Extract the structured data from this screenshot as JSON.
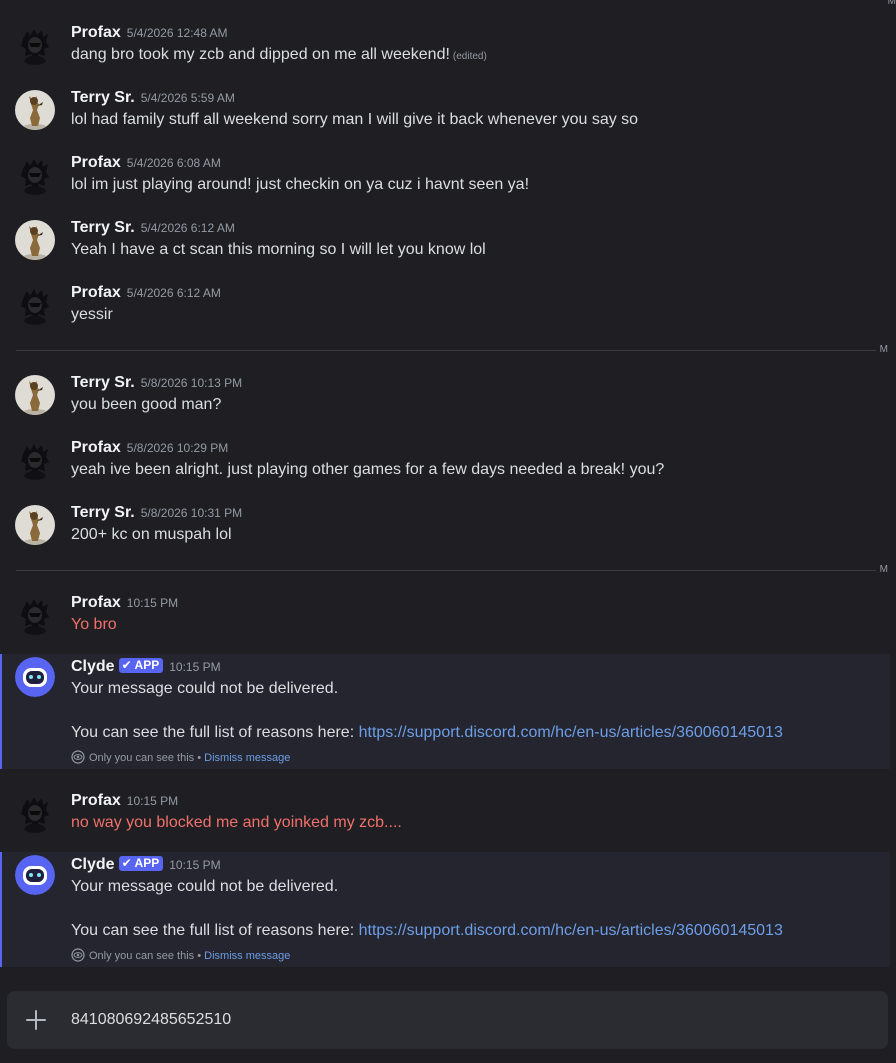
{
  "messages": [
    {
      "author": "Profax",
      "timestamp": "5/4/2026 12:48 AM",
      "text": "dang bro took my zcb and dipped on me all weekend!",
      "edited": "(edited)"
    },
    {
      "author": "Terry Sr.",
      "timestamp": "5/4/2026 5:59 AM",
      "text": "lol had family stuff all weekend sorry man I will give it back whenever you say so"
    },
    {
      "author": "Profax",
      "timestamp": "5/4/2026 6:08 AM",
      "text": "lol im just playing around! just checkin on ya cuz i havnt seen ya!"
    },
    {
      "author": "Terry Sr.",
      "timestamp": "5/4/2026 6:12 AM",
      "text": "Yeah I have a ct scan this morning so I will let you know lol"
    },
    {
      "author": "Profax",
      "timestamp": "5/4/2026 6:12 AM",
      "text": "yessir"
    },
    {
      "author": "Terry Sr.",
      "timestamp": "5/8/2026 10:13 PM",
      "text": "you been good man?"
    },
    {
      "author": "Profax",
      "timestamp": "5/8/2026 10:29 PM",
      "text": "yeah ive been alright. just playing other games for a few days needed a break! you?"
    },
    {
      "author": "Terry Sr.",
      "timestamp": "5/8/2026 10:31 PM",
      "text": "200+ kc on muspah lol"
    },
    {
      "author": "Profax",
      "timestamp": "10:15 PM",
      "text": "Yo bro",
      "failed": true
    },
    {
      "author": "Profax",
      "timestamp": "10:15 PM",
      "text": "no way you blocked me and yoinked my zcb....",
      "failed": true
    }
  ],
  "dividers": [
    {
      "mark": "M"
    },
    {
      "mark": "M"
    }
  ],
  "top_mark": "M",
  "clyde": {
    "author": "Clyde",
    "badge": "APP",
    "timestamp": "10:15 PM",
    "line1": "Your message could not be delivered.",
    "line2_prefix": "You can see the full list of reasons here:",
    "link": "https://support.discord.com/hc/en-us/articles/360060145013",
    "note": "Only you can see this",
    "separator": "•",
    "dismiss": "Dismiss message"
  },
  "composer": {
    "value": "841080692485652510"
  },
  "colors": {
    "background": "#1f1f23",
    "clyde_background": "#24252e",
    "accent": "#5865f2",
    "link": "#6d9ee8",
    "failed_text": "#f0706a"
  },
  "icons": [
    "profax-avatar",
    "terry-avatar",
    "clyde-avatar",
    "checkmark-icon",
    "eye-icon",
    "plus-icon"
  ]
}
